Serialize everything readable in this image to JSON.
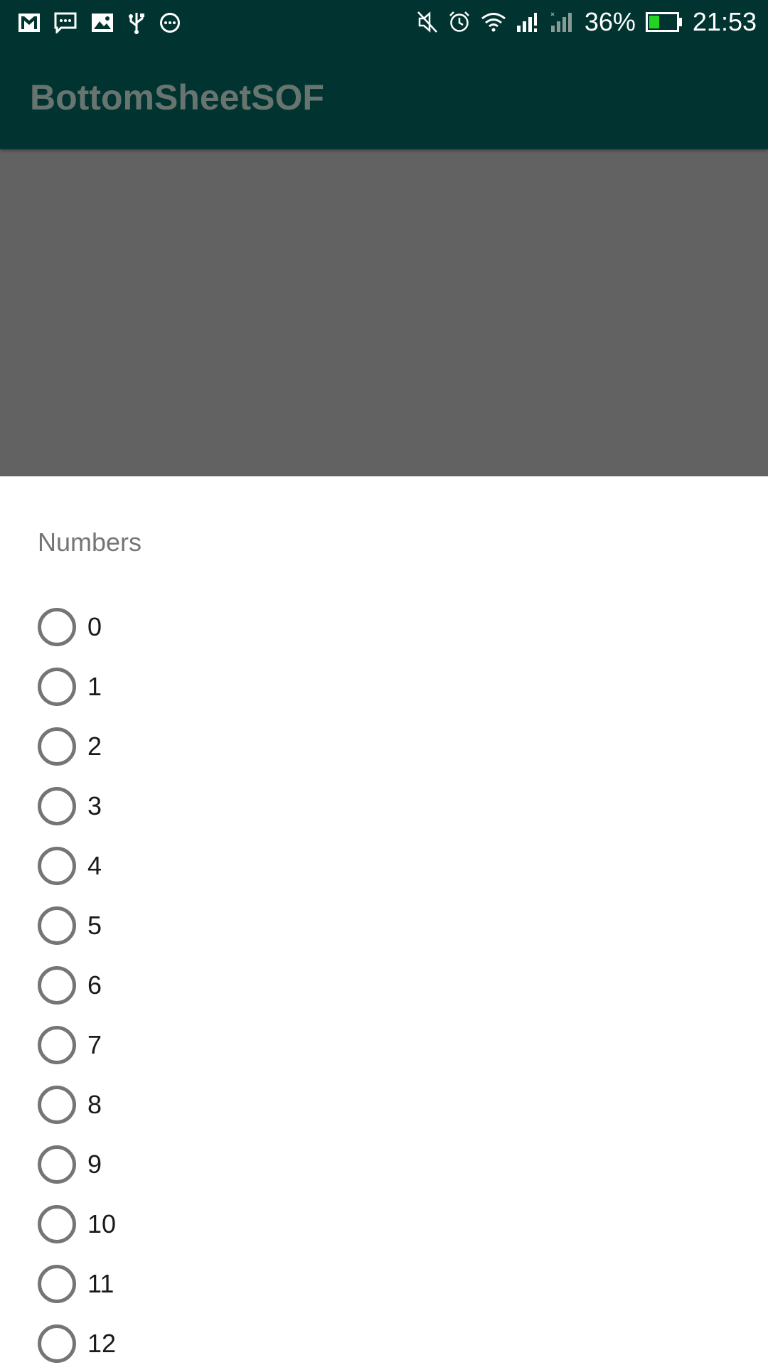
{
  "status_bar": {
    "left_icons": [
      "gmail-icon",
      "message-icon",
      "gallery-icon",
      "usb-icon",
      "more-notifications-icon"
    ],
    "right_icons": [
      "mute-icon",
      "alarm-icon",
      "wifi-icon",
      "signal-icon",
      "signal-2-icon"
    ],
    "battery_percent": "36%",
    "battery_level": 0.36,
    "time": "21:53"
  },
  "app_bar": {
    "title": "BottomSheetSOF"
  },
  "colors": {
    "primary_dark": "#013430",
    "scrim": "#626262",
    "radio_gray": "#757575",
    "battery_green": "#21d521"
  },
  "sheet": {
    "title": "Numbers",
    "options": [
      {
        "label": "0",
        "checked": false
      },
      {
        "label": "1",
        "checked": false
      },
      {
        "label": "2",
        "checked": false
      },
      {
        "label": "3",
        "checked": false
      },
      {
        "label": "4",
        "checked": false
      },
      {
        "label": "5",
        "checked": false
      },
      {
        "label": "6",
        "checked": false
      },
      {
        "label": "7",
        "checked": false
      },
      {
        "label": "8",
        "checked": false
      },
      {
        "label": "9",
        "checked": false
      },
      {
        "label": "10",
        "checked": false
      },
      {
        "label": "11",
        "checked": false
      },
      {
        "label": "12",
        "checked": false
      }
    ]
  }
}
